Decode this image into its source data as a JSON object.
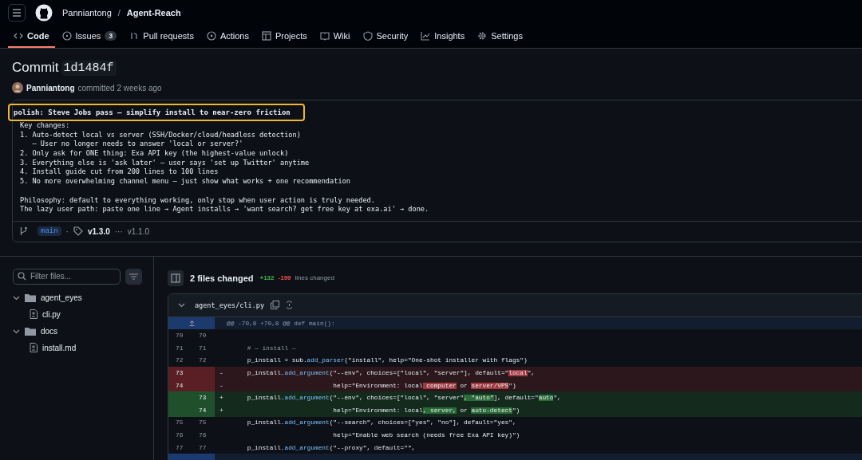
{
  "header": {
    "owner": "Panniantong",
    "separator": "/",
    "repo": "Agent-Reach"
  },
  "tabs": [
    {
      "label": "Code",
      "selected": true
    },
    {
      "label": "Issues",
      "count": "3",
      "selected": false
    },
    {
      "label": "Pull requests",
      "selected": false
    },
    {
      "label": "Actions",
      "selected": false
    },
    {
      "label": "Projects",
      "selected": false
    },
    {
      "label": "Wiki",
      "selected": false
    },
    {
      "label": "Security",
      "selected": false
    },
    {
      "label": "Insights",
      "selected": false
    },
    {
      "label": "Settings",
      "selected": false
    }
  ],
  "commit": {
    "title": "Commit",
    "sha": "1d1484f",
    "author": "Panniantong",
    "when": "committed 2 weeks ago",
    "headline": "polish: Steve Jobs pass — simplify install to near-zero friction",
    "highlighted": true,
    "body": [
      [
        "Key changes:",
        "1. Auto-detect local vs server (SSH/Docker/cloud/headless detection)",
        "   – User no longer needs to answer 'local or server?'",
        "2. Only ask for ONE thing: Exa API key (the highest-value unlock)",
        "3. Everything else is 'ask later' — user says 'set up Twitter' anytime",
        "4. Install guide cut from 200 lines to 100 lines",
        "5. No more overwhelming channel menu — just show what works + one recommendation"
      ],
      [
        "Philosophy: default to everything working, only stop when user action is truly needed.",
        "The lazy user path: paste one line → Agent installs → 'want search? get free key at exa.ai' → done."
      ]
    ],
    "branch": "main",
    "separator": "·",
    "tag": "v1.3.0",
    "ellipsis": "···",
    "older_tag": "v1.1.0"
  },
  "sidebar": {
    "filter_placeholder": "Filter files...",
    "tree": [
      {
        "kind": "folder",
        "name": "agent_eyes",
        "expanded": true,
        "children": [
          {
            "kind": "file",
            "name": "cli.py"
          }
        ]
      },
      {
        "kind": "folder",
        "name": "docs",
        "expanded": true,
        "children": [
          {
            "kind": "file",
            "name": "install.md"
          }
        ]
      }
    ]
  },
  "summary": {
    "files": "2 files changed",
    "added": "+132",
    "removed": "-199",
    "suffix": "lines changed"
  },
  "file": {
    "path": "agent_eyes/cli.py",
    "expanded": true,
    "hunk": "@@ -70,8 +70,8 @@ def main():",
    "lines": [
      {
        "kind": "context",
        "old": "70",
        "new": "70"
      },
      {
        "kind": "context",
        "old": "71",
        "new": "71",
        "segments": [
          {
            "kind": "comment",
            "text": "    # — install —"
          }
        ]
      },
      {
        "kind": "context",
        "old": "72",
        "new": "72",
        "segments": [
          {
            "kind": "text",
            "text": "    p_install = sub."
          },
          {
            "kind": "call",
            "text": "add_parser"
          },
          {
            "kind": "text",
            "text": "(\"install\", help=\"One-shot installer with flags\")"
          }
        ]
      },
      {
        "kind": "del",
        "old": "73",
        "sign": "-",
        "segments": [
          {
            "kind": "text",
            "text": "    p_install."
          },
          {
            "kind": "call",
            "text": "add_argument"
          },
          {
            "kind": "text",
            "text": "(\"--env\", choices=[\"local\", \"server\"], default=\""
          },
          {
            "kind": "change",
            "text": "local"
          },
          {
            "kind": "text",
            "text": "\","
          }
        ]
      },
      {
        "kind": "del",
        "old": "74",
        "sign": "-",
        "segments": [
          {
            "kind": "text",
            "text": "                           help=\"Environment: local"
          },
          {
            "kind": "change",
            "text": " computer"
          },
          {
            "kind": "text",
            "text": " or "
          },
          {
            "kind": "change",
            "text": "server/VPS"
          },
          {
            "kind": "text",
            "text": "\")"
          }
        ]
      },
      {
        "kind": "add",
        "new": "73",
        "sign": "+",
        "segments": [
          {
            "kind": "text",
            "text": "    p_install."
          },
          {
            "kind": "call",
            "text": "add_argument"
          },
          {
            "kind": "text",
            "text": "(\"--env\", choices=[\"local\", \"server\""
          },
          {
            "kind": "change",
            "text": ", \"auto\""
          },
          {
            "kind": "text",
            "text": "], default=\""
          },
          {
            "kind": "change",
            "text": "auto"
          },
          {
            "kind": "text",
            "text": "\","
          }
        ]
      },
      {
        "kind": "add",
        "new": "74",
        "sign": "+",
        "segments": [
          {
            "kind": "text",
            "text": "                           help=\"Environment: local"
          },
          {
            "kind": "change",
            "text": ", server,"
          },
          {
            "kind": "text",
            "text": " or "
          },
          {
            "kind": "change",
            "text": "auto-detect"
          },
          {
            "kind": "text",
            "text": "\")"
          }
        ]
      },
      {
        "kind": "context",
        "old": "75",
        "new": "75",
        "segments": [
          {
            "kind": "text",
            "text": "    p_install."
          },
          {
            "kind": "call",
            "text": "add_argument"
          },
          {
            "kind": "text",
            "text": "(\"--search\", choices=[\"yes\", \"no\"], default=\"yes\","
          }
        ]
      },
      {
        "kind": "context",
        "old": "76",
        "new": "76",
        "segments": [
          {
            "kind": "text",
            "text": "                           help=\"Enable web search (needs free Exa API key)\")"
          }
        ]
      },
      {
        "kind": "context",
        "old": "77",
        "new": "77",
        "segments": [
          {
            "kind": "text",
            "text": "    p_install."
          },
          {
            "kind": "call",
            "text": "add_argument"
          },
          {
            "kind": "text",
            "text": "(\"--proxy\", default=\"\","
          }
        ]
      }
    ]
  }
}
